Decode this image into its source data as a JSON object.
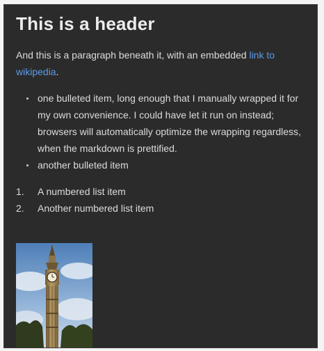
{
  "document": {
    "heading": "This is a header",
    "intro": {
      "text_before": "And this is a paragraph beneath it, with an embedded ",
      "link_text": "link to wikipedia",
      "text_after": "."
    },
    "bullets": [
      "one bulleted item, long enough that I manually wrapped it for my own convenience. I could have let it run on instead; browsers will automatically optimize the wrapping regardless, when the markdown is prettified.",
      "another bulleted item"
    ],
    "numbered": [
      {
        "marker": "1.",
        "text": "A numbered list item"
      },
      {
        "marker": "2.",
        "text": "Another numbered list item"
      }
    ],
    "image": {
      "subject": "clock-tower-photo"
    }
  },
  "colors": {
    "background": "#2b2b2b",
    "text": "#dcdcdc",
    "heading": "#ececec",
    "link": "#5d9be6"
  }
}
